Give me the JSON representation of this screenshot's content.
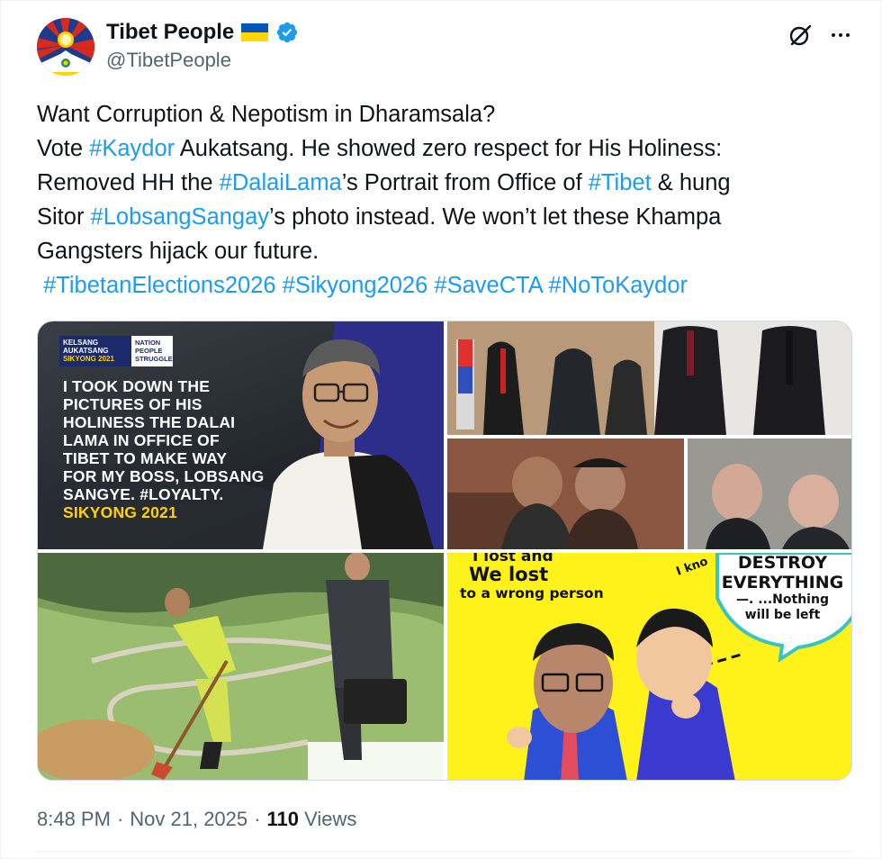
{
  "author": {
    "display_name": "Tibet People",
    "handle": "@TibetPeople",
    "flag_icon": "ukraine-flag",
    "verified_icon": "verified-badge",
    "colors": {
      "verified": "#1d9bf0",
      "flag_blue": "#0057b7",
      "flag_yellow": "#ffd700"
    }
  },
  "actions": {
    "grok_icon": "grok-icon",
    "more_icon": "more-icon"
  },
  "tweet": {
    "line1": "Want Corruption & Nepotism in Dharamsala?",
    "line2_pre": "Vote ",
    "line2_tag": "#Kaydor",
    "line2_post": " Aukatsang. He showed zero respect for His Holiness:",
    "line3_pre": "Removed HH the ",
    "line3_tag1": "#DalaiLama",
    "line3_mid": "’s Portrait from Office of ",
    "line3_tag2": "#Tibet",
    "line3_post": " & hung",
    "line4_pre": "Sitor ",
    "line4_tag": "#LobsangSangay",
    "line4_post": "’s photo instead. We won’t let these Khampa",
    "line5": "Gangsters hijack our future.",
    "tags_line": [
      " #TibetanElections2026",
      "#Sikyong2026",
      "#SaveCTA",
      "#NoToKaydor"
    ],
    "hashtag_color": "#1d9bf0"
  },
  "media": {
    "tile1": {
      "logo_line1": "KELSANG",
      "logo_line2": "AUKATSANG",
      "logo_line3": "SIKYONG 2021",
      "tag_line1": "NATION",
      "tag_line2": "PEOPLE",
      "tag_line3": "STRUGGLE",
      "quote_lines": [
        "I TOOK DOWN THE",
        "PICTURES OF HIS",
        "HOLINESS THE DALAI",
        "LAMA IN OFFICE OF",
        "TIBET TO MAKE WAY",
        "FOR MY BOSS, LOBSANG",
        "SANGYE. #LOYALTY."
      ],
      "footer": "SIKYONG 2021"
    },
    "tile4": {
      "top_partial": "I lost and",
      "we_lost": "We lost",
      "wrong_person": "to a wrong person",
      "i_know": "I kno",
      "bubble_line1": "DESTROY",
      "bubble_line2": "EVERYTHING",
      "bubble_line3": "—. ...Nothing",
      "bubble_line4": "will be left"
    }
  },
  "meta": {
    "time": "8:48 PM",
    "sep1": "·",
    "date": "Nov 21, 2025",
    "sep2": "·",
    "views_count": "110",
    "views_label": "Views"
  }
}
